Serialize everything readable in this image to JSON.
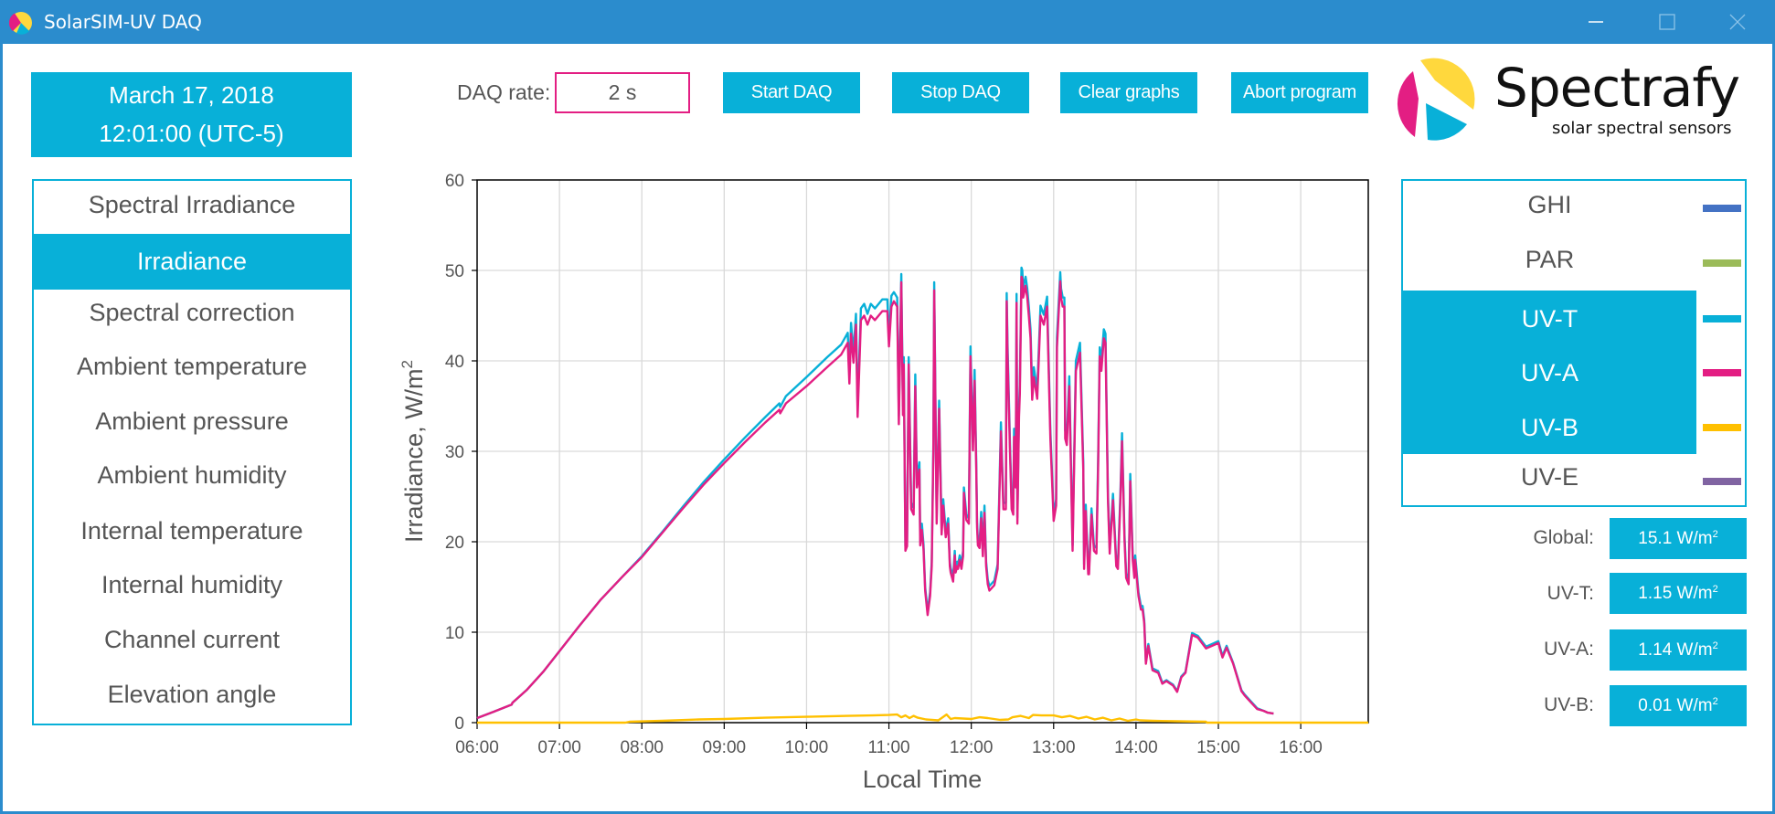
{
  "window": {
    "title": "SolarSIM-UV DAQ",
    "controls": [
      "minimize",
      "maximize",
      "close"
    ]
  },
  "datetime": {
    "date": "March 17, 2018",
    "time": "12:01:00 (UTC-5)"
  },
  "menu": {
    "items": [
      {
        "label": "Spectral Irradiance",
        "selected": false
      },
      {
        "label": "Irradiance",
        "selected": true
      },
      {
        "label": "Spectral correction",
        "selected": false
      },
      {
        "label": "Ambient temperature",
        "selected": false
      },
      {
        "label": "Ambient pressure",
        "selected": false
      },
      {
        "label": "Ambient humidity",
        "selected": false
      },
      {
        "label": "Internal temperature",
        "selected": false
      },
      {
        "label": "Internal humidity",
        "selected": false
      },
      {
        "label": "Channel current",
        "selected": false
      },
      {
        "label": "Elevation angle",
        "selected": false
      }
    ]
  },
  "toolbar": {
    "daq_rate_label": "DAQ rate:",
    "daq_rate_value": "2 s",
    "start_label": "Start DAQ",
    "stop_label": "Stop DAQ",
    "clear_label": "Clear graphs",
    "abort_label": "Abort program"
  },
  "logo": {
    "brand": "Spectrafy",
    "tagline": "solar spectral sensors"
  },
  "legend": {
    "items": [
      {
        "label": "GHI",
        "color": "#4472c4",
        "selected": false
      },
      {
        "label": "PAR",
        "color": "#9bbb59",
        "selected": false
      },
      {
        "label": "UV-T",
        "color": "#08b0d8",
        "selected": true
      },
      {
        "label": "UV-A",
        "color": "#e31e83",
        "selected": true
      },
      {
        "label": "UV-B",
        "color": "#ffc000",
        "selected": true
      },
      {
        "label": "UV-E",
        "color": "#8064a2",
        "selected": false
      }
    ]
  },
  "readouts": [
    {
      "label": "Global:",
      "value": "15.1 W/m",
      "sup": "2"
    },
    {
      "label": "UV-T:",
      "value": "1.15 W/m",
      "sup": "2"
    },
    {
      "label": "UV-A:",
      "value": "1.14 W/m",
      "sup": "2"
    },
    {
      "label": "UV-B:",
      "value": "0.01 W/m",
      "sup": "2"
    }
  ],
  "colors": {
    "accent": "#08b0d8",
    "titlebar": "#2b8ccd",
    "input_border": "#e31e83"
  },
  "chart_data": {
    "type": "line",
    "title": "",
    "xlabel": "Local Time",
    "ylabel": "Irradiance, W/m",
    "ylabel_sup": "2",
    "xlim": [
      6.0,
      16.82
    ],
    "ylim": [
      0,
      60
    ],
    "xticks": [
      "06:00",
      "07:00",
      "08:00",
      "09:00",
      "10:00",
      "11:00",
      "12:00",
      "13:00",
      "14:00",
      "15:00",
      "16:00"
    ],
    "yticks": [
      "0",
      "10",
      "20",
      "30",
      "40",
      "50",
      "60"
    ],
    "grid": true,
    "legend": "none",
    "series": [
      {
        "name": "UV-A",
        "color": "#e31e83",
        "x": [
          6.0,
          6.2,
          6.42,
          6.43,
          6.6,
          6.8,
          7.0,
          7.25,
          7.5,
          7.75,
          8.0,
          8.25,
          8.5,
          8.75,
          9.0,
          9.25,
          9.5,
          9.67,
          9.68,
          9.75,
          10.0,
          10.25,
          10.42,
          10.5,
          10.52,
          10.54,
          10.57,
          10.6,
          10.62,
          10.66,
          10.7,
          10.74,
          10.78,
          10.83,
          10.92,
          10.98,
          11.0,
          11.03,
          11.06,
          11.1,
          11.12,
          11.15,
          11.17,
          11.18,
          11.2,
          11.22,
          11.24,
          11.27,
          11.3,
          11.32,
          11.34,
          11.37,
          11.38,
          11.4,
          11.42,
          11.44,
          11.47,
          11.5,
          11.52,
          11.54,
          11.55,
          11.58,
          11.61,
          11.64,
          11.66,
          11.69,
          11.72,
          11.74,
          11.75,
          11.78,
          11.8,
          11.81,
          11.83,
          11.84,
          11.86,
          11.88,
          11.9,
          11.91,
          11.94,
          11.97,
          11.99,
          12.02,
          12.04,
          12.06,
          12.07,
          12.08,
          12.1,
          12.12,
          12.14,
          12.16,
          12.18,
          12.2,
          12.22,
          12.25,
          12.28,
          12.32,
          12.36,
          12.39,
          12.42,
          12.43,
          12.44,
          12.47,
          12.49,
          12.51,
          12.52,
          12.54,
          12.55,
          12.56,
          12.58,
          12.59,
          12.61,
          12.62,
          12.63,
          12.66,
          12.68,
          12.7,
          12.72,
          12.74,
          12.76,
          12.8,
          12.84,
          12.88,
          12.92,
          12.96,
          13.0,
          13.03,
          13.04,
          13.08,
          13.09,
          13.11,
          13.13,
          13.14,
          13.16,
          13.19,
          13.23,
          13.27,
          13.32,
          13.36,
          13.37,
          13.39,
          13.42,
          13.43,
          13.46,
          13.49,
          13.52,
          13.54,
          13.56,
          13.58,
          13.61,
          13.63,
          13.66,
          13.68,
          13.72,
          13.76,
          13.78,
          13.81,
          13.83,
          13.86,
          13.88,
          13.91,
          13.93,
          13.96,
          13.98,
          13.99,
          14.03,
          14.06,
          14.08,
          14.1,
          14.12,
          14.15,
          14.2,
          14.27,
          14.32,
          14.37,
          14.4,
          14.45,
          14.5,
          14.55,
          14.6,
          14.68,
          14.75,
          14.85,
          15.0,
          15.05,
          15.1,
          15.18,
          15.28,
          15.32,
          15.4,
          15.47,
          15.55,
          15.6,
          15.67,
          15.75,
          15.82,
          15.9,
          16.0,
          16.08,
          16.2,
          16.3,
          16.4,
          16.5,
          16.6,
          16.7,
          16.82
        ],
        "y": [
          0.5,
          1.2,
          2.0,
          2.2,
          3.6,
          5.6,
          7.9,
          10.8,
          13.6,
          16.0,
          18.3,
          21.0,
          23.7,
          26.3,
          28.7,
          31.0,
          33.2,
          34.6,
          34.2,
          35.3,
          37.2,
          39.3,
          40.7,
          42.0,
          37.5,
          43.0,
          39.8,
          44.0,
          33.8,
          44.5,
          45.0,
          44.0,
          45.0,
          44.5,
          45.5,
          45.5,
          41.6,
          46.0,
          46.6,
          46.0,
          33.0,
          48.7,
          34.0,
          39.6,
          19.0,
          19.5,
          39.6,
          23.6,
          23.0,
          37.2,
          26.0,
          28.0,
          19.6,
          21.3,
          19.2,
          14.6,
          11.9,
          14.0,
          17.3,
          30.0,
          47.8,
          22.0,
          34.7,
          20.8,
          24.0,
          20.5,
          22.0,
          17.3,
          16.6,
          15.6,
          18.5,
          16.6,
          17.3,
          17.0,
          18.0,
          17.0,
          18.4,
          25.4,
          22.4,
          22.0,
          40.5,
          30.1,
          37.8,
          28.0,
          21.6,
          19.6,
          19.3,
          22.6,
          18.4,
          23.2,
          17.3,
          15.3,
          14.6,
          14.9,
          15.2,
          17.0,
          32.2,
          23.6,
          23.6,
          46.6,
          40.8,
          30.0,
          23.6,
          23.0,
          31.6,
          26.0,
          46.4,
          22.0,
          33.8,
          36.4,
          49.3,
          49.0,
          47.0,
          48.3,
          47.0,
          44.9,
          42.5,
          35.7,
          38.2,
          35.8,
          45.0,
          44.0,
          46.0,
          31.4,
          22.3,
          24.0,
          41.5,
          48.8,
          47.0,
          46.0,
          46.0,
          31.4,
          30.7,
          37.2,
          19.0,
          38.9,
          40.9,
          28.0,
          17.0,
          23.4,
          16.4,
          16.4,
          23.0,
          19.0,
          18.7,
          28.0,
          40.5,
          38.9,
          42.5,
          42.0,
          24.6,
          18.7,
          24.6,
          17.3,
          17.0,
          24.6,
          31.1,
          20.2,
          16.0,
          15.3,
          26.7,
          18.0,
          16.0,
          18.0,
          14.0,
          12.5,
          12.5,
          11.0,
          6.5,
          8.5,
          5.8,
          5.5,
          4.3,
          4.6,
          4.4,
          4.1,
          3.4,
          5.0,
          5.5,
          9.7,
          9.4,
          8.2,
          8.8,
          7.2,
          8.3,
          6.5,
          3.5,
          3.0,
          2.2,
          1.5,
          1.3,
          1.1,
          1.0
        ]
      },
      {
        "name": "UV-T",
        "color": "#08b0d8",
        "offset_note": "tracks UV-A closely, ~1 W/m2 higher near peaks",
        "x": [
          6.0,
          6.2,
          6.42,
          6.43,
          6.6,
          6.8,
          7.0,
          7.25,
          7.5,
          7.75,
          8.0,
          8.25,
          8.5,
          8.75,
          9.0,
          9.25,
          9.5,
          9.67,
          9.68,
          9.75,
          10.0,
          10.25,
          10.42,
          10.5,
          10.52,
          10.54,
          10.57,
          10.6,
          10.62,
          10.66,
          10.7,
          10.74,
          10.78,
          10.83,
          10.92,
          10.98,
          11.0,
          11.03,
          11.06,
          11.1,
          11.12,
          11.15,
          11.17,
          11.18,
          11.2,
          11.22,
          11.24,
          11.27,
          11.3,
          11.32,
          11.34,
          11.37,
          11.38,
          11.4,
          11.42,
          11.44,
          11.47,
          11.5,
          11.52,
          11.54,
          11.55,
          11.58,
          11.61,
          11.64,
          11.66,
          11.69,
          11.72,
          11.74,
          11.75,
          11.78,
          11.8,
          11.81,
          11.83,
          11.84,
          11.86,
          11.88,
          11.9,
          11.91,
          11.94,
          11.97,
          11.99,
          12.02,
          12.04,
          12.06,
          12.07,
          12.08,
          12.1,
          12.12,
          12.14,
          12.16,
          12.18,
          12.2,
          12.22,
          12.25,
          12.28,
          12.32,
          12.36,
          12.39,
          12.42,
          12.43,
          12.44,
          12.47,
          12.49,
          12.51,
          12.52,
          12.54,
          12.55,
          12.56,
          12.58,
          12.59,
          12.61,
          12.62,
          12.63,
          12.66,
          12.68,
          12.7,
          12.72,
          12.74,
          12.76,
          12.8,
          12.84,
          12.88,
          12.92,
          12.96,
          13.0,
          13.03,
          13.04,
          13.08,
          13.09,
          13.11,
          13.13,
          13.14,
          13.16,
          13.19,
          13.23,
          13.27,
          13.32,
          13.36,
          13.37,
          13.39,
          13.42,
          13.43,
          13.46,
          13.49,
          13.52,
          13.54,
          13.56,
          13.58,
          13.61,
          13.63,
          13.66,
          13.68,
          13.72,
          13.76,
          13.78,
          13.81,
          13.83,
          13.86,
          13.88,
          13.91,
          13.93,
          13.96,
          13.98,
          13.99,
          14.03,
          14.06,
          14.08,
          14.1,
          14.12,
          14.15,
          14.2,
          14.27,
          14.32,
          14.37,
          14.4,
          14.45,
          14.5,
          14.55,
          14.6,
          14.68,
          14.75,
          14.85,
          15.0,
          15.05,
          15.1,
          15.18,
          15.28,
          15.32,
          15.4,
          15.47,
          15.55,
          15.6,
          15.67,
          15.75,
          15.82,
          15.9,
          16.0,
          16.08,
          16.2,
          16.3,
          16.4,
          16.5,
          16.6,
          16.7,
          16.82
        ],
        "y": [
          0.5,
          1.2,
          2.0,
          2.2,
          3.6,
          5.6,
          7.9,
          10.8,
          13.6,
          16.0,
          18.4,
          21.1,
          23.9,
          26.6,
          29.1,
          31.5,
          33.8,
          35.3,
          34.9,
          36.1,
          38.2,
          40.4,
          41.8,
          43.1,
          38.5,
          44.2,
          40.9,
          45.2,
          34.8,
          45.8,
          46.3,
          45.2,
          46.3,
          45.8,
          46.8,
          46.8,
          42.7,
          47.2,
          47.6,
          47.0,
          33.9,
          49.6,
          35.0,
          40.4,
          19.5,
          20.0,
          40.4,
          24.3,
          23.7,
          38.5,
          26.8,
          28.8,
          20.2,
          22.0,
          19.7,
          15.0,
          12.3,
          14.4,
          17.8,
          30.9,
          48.7,
          22.7,
          35.6,
          21.4,
          24.7,
          21.1,
          22.6,
          17.8,
          17.1,
          16.1,
          19.0,
          17.1,
          17.8,
          17.5,
          18.5,
          17.5,
          19.0,
          26.0,
          23.0,
          22.6,
          41.6,
          31.0,
          39.0,
          28.8,
          22.2,
          20.2,
          19.9,
          23.3,
          19.0,
          24.0,
          17.8,
          15.8,
          15.1,
          15.4,
          15.7,
          17.5,
          33.2,
          24.3,
          24.3,
          47.5,
          42.0,
          30.9,
          24.3,
          23.7,
          32.5,
          26.8,
          47.4,
          22.7,
          34.8,
          37.5,
          50.3,
          50.0,
          48.0,
          49.3,
          48.0,
          45.9,
          43.5,
          36.7,
          39.3,
          36.8,
          46.1,
          45.1,
          47.1,
          32.3,
          23.0,
          24.7,
          42.6,
          49.8,
          48.0,
          47.0,
          47.0,
          32.3,
          31.6,
          38.3,
          19.6,
          40.0,
          42.0,
          28.8,
          17.5,
          24.1,
          16.9,
          16.9,
          23.7,
          19.6,
          19.3,
          28.8,
          41.5,
          40.0,
          43.5,
          43.0,
          25.3,
          19.3,
          25.3,
          17.8,
          17.5,
          25.3,
          32.0,
          20.8,
          16.5,
          15.8,
          27.5,
          18.5,
          16.5,
          18.5,
          14.4,
          12.9,
          12.9,
          11.3,
          6.7,
          8.7,
          6.0,
          5.7,
          4.4,
          4.7,
          4.5,
          4.2,
          3.5,
          5.1,
          5.6,
          9.9,
          9.6,
          8.4,
          9.0,
          7.4,
          8.5,
          6.6,
          3.6,
          3.1,
          2.3,
          1.6,
          1.3,
          1.1,
          1.0
        ]
      },
      {
        "name": "UV-B",
        "color": "#ffc000",
        "x": [
          6.0,
          7.8,
          7.85,
          8.25,
          8.7,
          9.0,
          9.5,
          10.0,
          10.5,
          10.8,
          11.0,
          11.1,
          11.15,
          11.2,
          11.25,
          11.3,
          11.35,
          11.45,
          11.6,
          11.7,
          11.75,
          11.8,
          11.9,
          12.0,
          12.1,
          12.2,
          12.35,
          12.45,
          12.5,
          12.6,
          12.7,
          12.75,
          12.85,
          13.0,
          13.1,
          13.2,
          13.3,
          13.4,
          13.5,
          13.6,
          13.7,
          13.8,
          13.9,
          14.0,
          14.05,
          14.2,
          14.5,
          14.85,
          14.86,
          16.82
        ],
        "y": [
          0.0,
          0.0,
          0.1,
          0.2,
          0.35,
          0.4,
          0.55,
          0.65,
          0.75,
          0.8,
          0.85,
          0.9,
          0.6,
          0.8,
          0.5,
          0.75,
          0.55,
          0.35,
          0.25,
          0.9,
          0.4,
          0.5,
          0.45,
          0.4,
          0.6,
          0.5,
          0.3,
          0.35,
          0.6,
          0.75,
          0.5,
          0.85,
          0.8,
          0.8,
          0.6,
          0.75,
          0.45,
          0.65,
          0.35,
          0.55,
          0.25,
          0.45,
          0.2,
          0.35,
          0.25,
          0.2,
          0.15,
          0.1,
          0.0,
          0.0
        ]
      }
    ]
  }
}
